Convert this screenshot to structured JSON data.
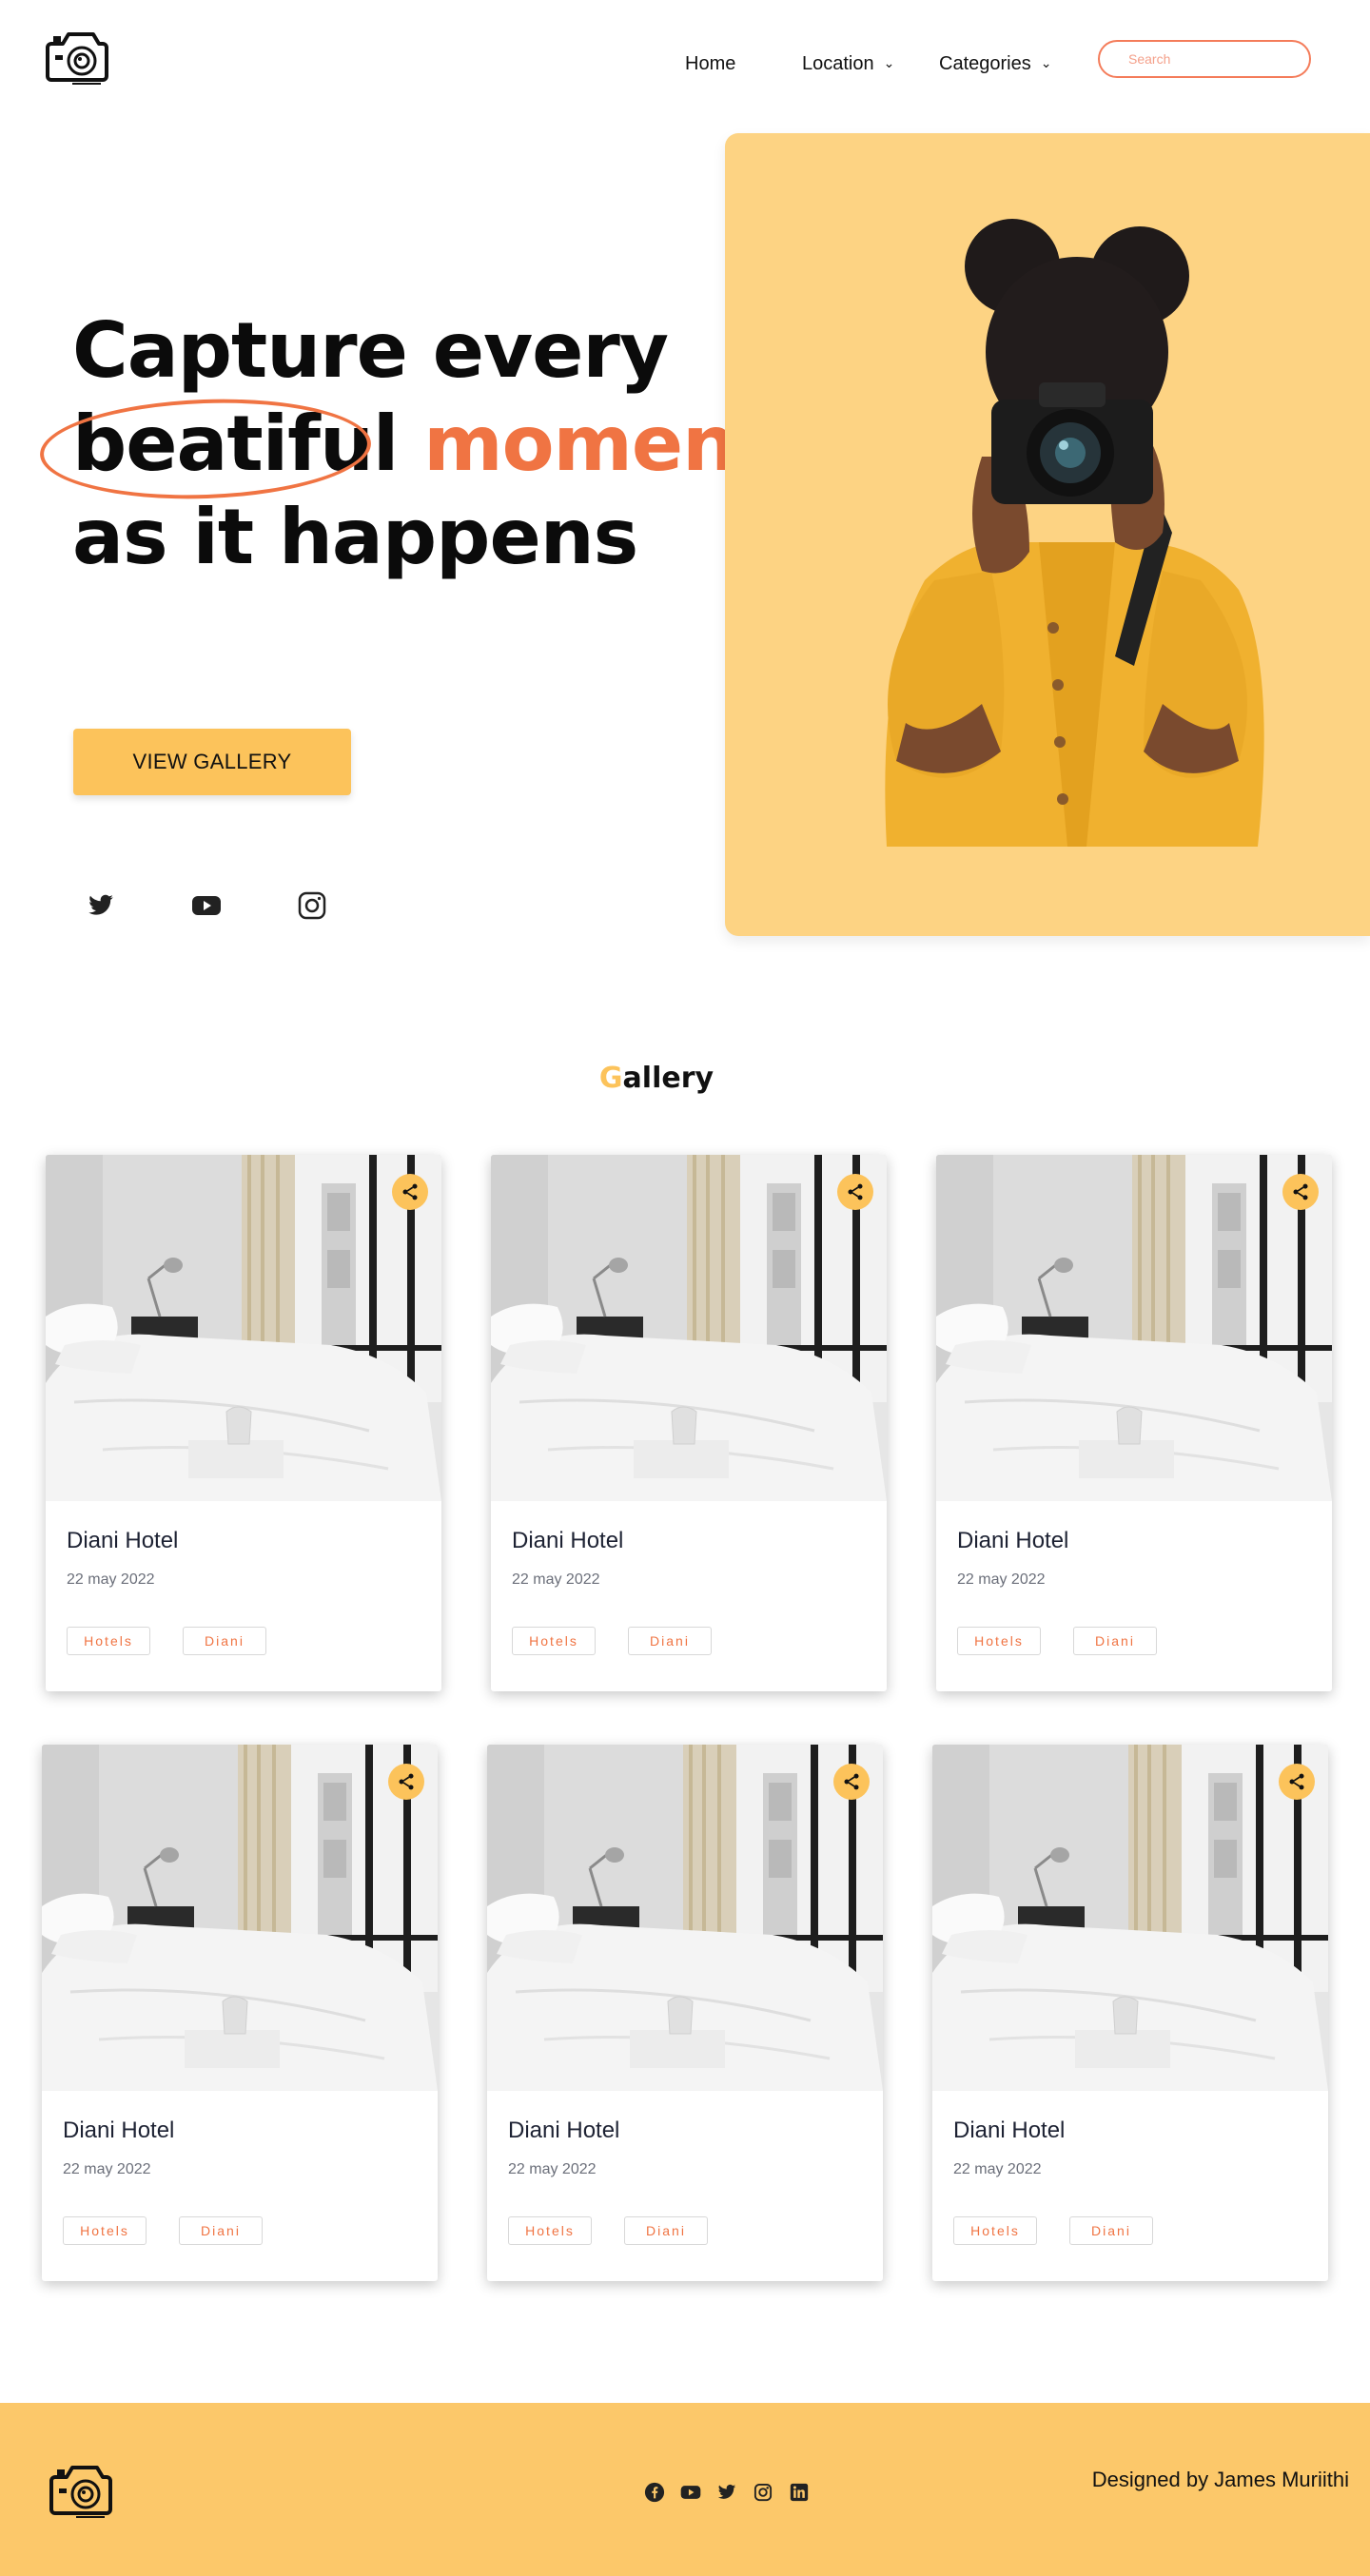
{
  "nav": {
    "home": "Home",
    "location": "Location",
    "categories": "Categories",
    "search_placeholder": "Search",
    "search_value": ""
  },
  "hero": {
    "line1": "Capture every",
    "line2_word1": "beatiful",
    "line2_word2": "moment",
    "line3": "as it happens",
    "cta": "VIEW GALLERY",
    "social": [
      "twitter-icon",
      "youtube-icon",
      "instagram-icon"
    ],
    "panel_color": "#fdd383",
    "accent": "#f07443"
  },
  "gallery": {
    "title_first": "G",
    "title_rest": "allery",
    "cards": [
      {
        "title": "Diani Hotel",
        "date": "22 may 2022",
        "tags": [
          "Hotels",
          "Diani"
        ]
      },
      {
        "title": "Diani Hotel",
        "date": "22 may 2022",
        "tags": [
          "Hotels",
          "Diani"
        ]
      },
      {
        "title": "Diani Hotel",
        "date": "22 may 2022",
        "tags": [
          "Hotels",
          "Diani"
        ]
      },
      {
        "title": "Diani Hotel",
        "date": "22 may 2022",
        "tags": [
          "Hotels",
          "Diani"
        ]
      },
      {
        "title": "Diani Hotel",
        "date": "22 may 2022",
        "tags": [
          "Hotels",
          "Diani"
        ]
      },
      {
        "title": "Diani Hotel",
        "date": "22 may 2022",
        "tags": [
          "Hotels",
          "Diani"
        ]
      }
    ]
  },
  "footer": {
    "icons": [
      "facebook-icon",
      "youtube-icon",
      "twitter-icon",
      "instagram-icon",
      "linkedin-icon"
    ],
    "credit": "Designed by James Muriithi",
    "background": "#fcc86a"
  },
  "colors": {
    "brand_yellow": "#fcc35b",
    "brand_orange": "#f07443"
  }
}
